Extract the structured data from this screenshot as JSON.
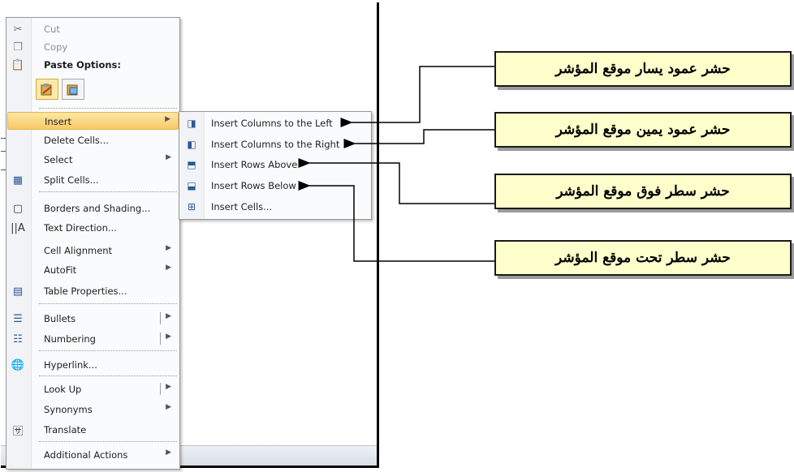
{
  "context_menu": {
    "items": [
      {
        "label": "Cut",
        "icon": "scissors-icon",
        "disabled": true
      },
      {
        "label": "Copy",
        "icon": "copy-icon",
        "disabled": true
      },
      {
        "label": "Paste Options:",
        "icon": "paste-icon"
      },
      {
        "label": "Insert",
        "submenu": true,
        "highlighted": true
      },
      {
        "label": "Delete Cells..."
      },
      {
        "label": "Select",
        "submenu": true
      },
      {
        "label": "Split Cells...",
        "icon": "split-cells-icon"
      },
      {
        "label": "Borders and Shading...",
        "icon": "borders-icon"
      },
      {
        "label": "Text Direction...",
        "icon": "text-direction-icon"
      },
      {
        "label": "Cell Alignment",
        "submenu": true
      },
      {
        "label": "AutoFit",
        "submenu": true
      },
      {
        "label": "Table Properties...",
        "icon": "table-properties-icon"
      },
      {
        "label": "Bullets",
        "icon": "bullets-icon",
        "split_submenu": true
      },
      {
        "label": "Numbering",
        "icon": "numbering-icon",
        "split_submenu": true
      },
      {
        "label": "Hyperlink...",
        "icon": "hyperlink-icon"
      },
      {
        "label": "Look Up",
        "split_submenu": true
      },
      {
        "label": "Synonyms",
        "submenu": true
      },
      {
        "label": "Translate",
        "icon": "translate-icon"
      },
      {
        "label": "Additional Actions",
        "submenu": true
      }
    ]
  },
  "insert_submenu": {
    "items": [
      {
        "label": "Insert Columns to the Left",
        "icon": "insert-columns-left-icon"
      },
      {
        "label": "Insert Columns to the Right",
        "icon": "insert-columns-right-icon"
      },
      {
        "label": "Insert Rows Above",
        "icon": "insert-rows-above-icon"
      },
      {
        "label": "Insert Rows Below",
        "icon": "insert-rows-below-icon"
      },
      {
        "label": "Insert Cells...",
        "icon": "insert-cells-icon"
      }
    ]
  },
  "callouts": [
    {
      "text": "حشر عمود يسار موقع المؤشر"
    },
    {
      "text": "حشر عمود يمين موقع المؤشر"
    },
    {
      "text": "حشر سطر فوق موقع المؤشر"
    },
    {
      "text": "حشر سطر تحت موقع المؤشر"
    }
  ],
  "colors": {
    "callout_fill": "#ffffcc",
    "highlight": "#f8c966"
  }
}
